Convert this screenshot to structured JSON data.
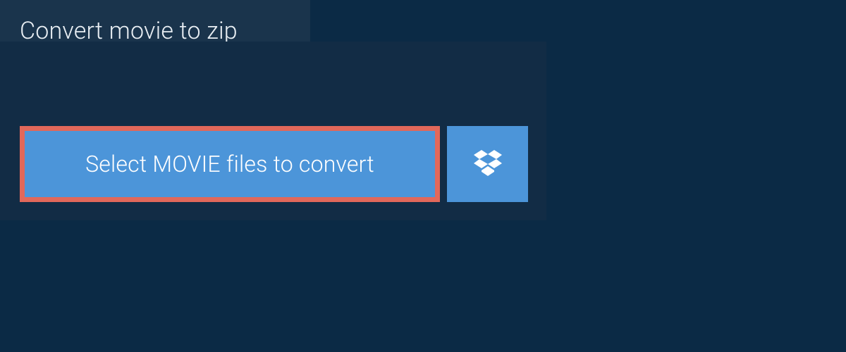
{
  "header": {
    "title": "Convert movie to zip"
  },
  "actions": {
    "select_label": "Select MOVIE files to convert"
  },
  "colors": {
    "page_bg": "#0b2a45",
    "panel_bg": "#122c45",
    "tab_bg": "#1a344c",
    "button_bg": "#4c95d9",
    "highlight_border": "#e1685a",
    "text_light": "#e8eef3",
    "text_white": "#ffffff"
  }
}
